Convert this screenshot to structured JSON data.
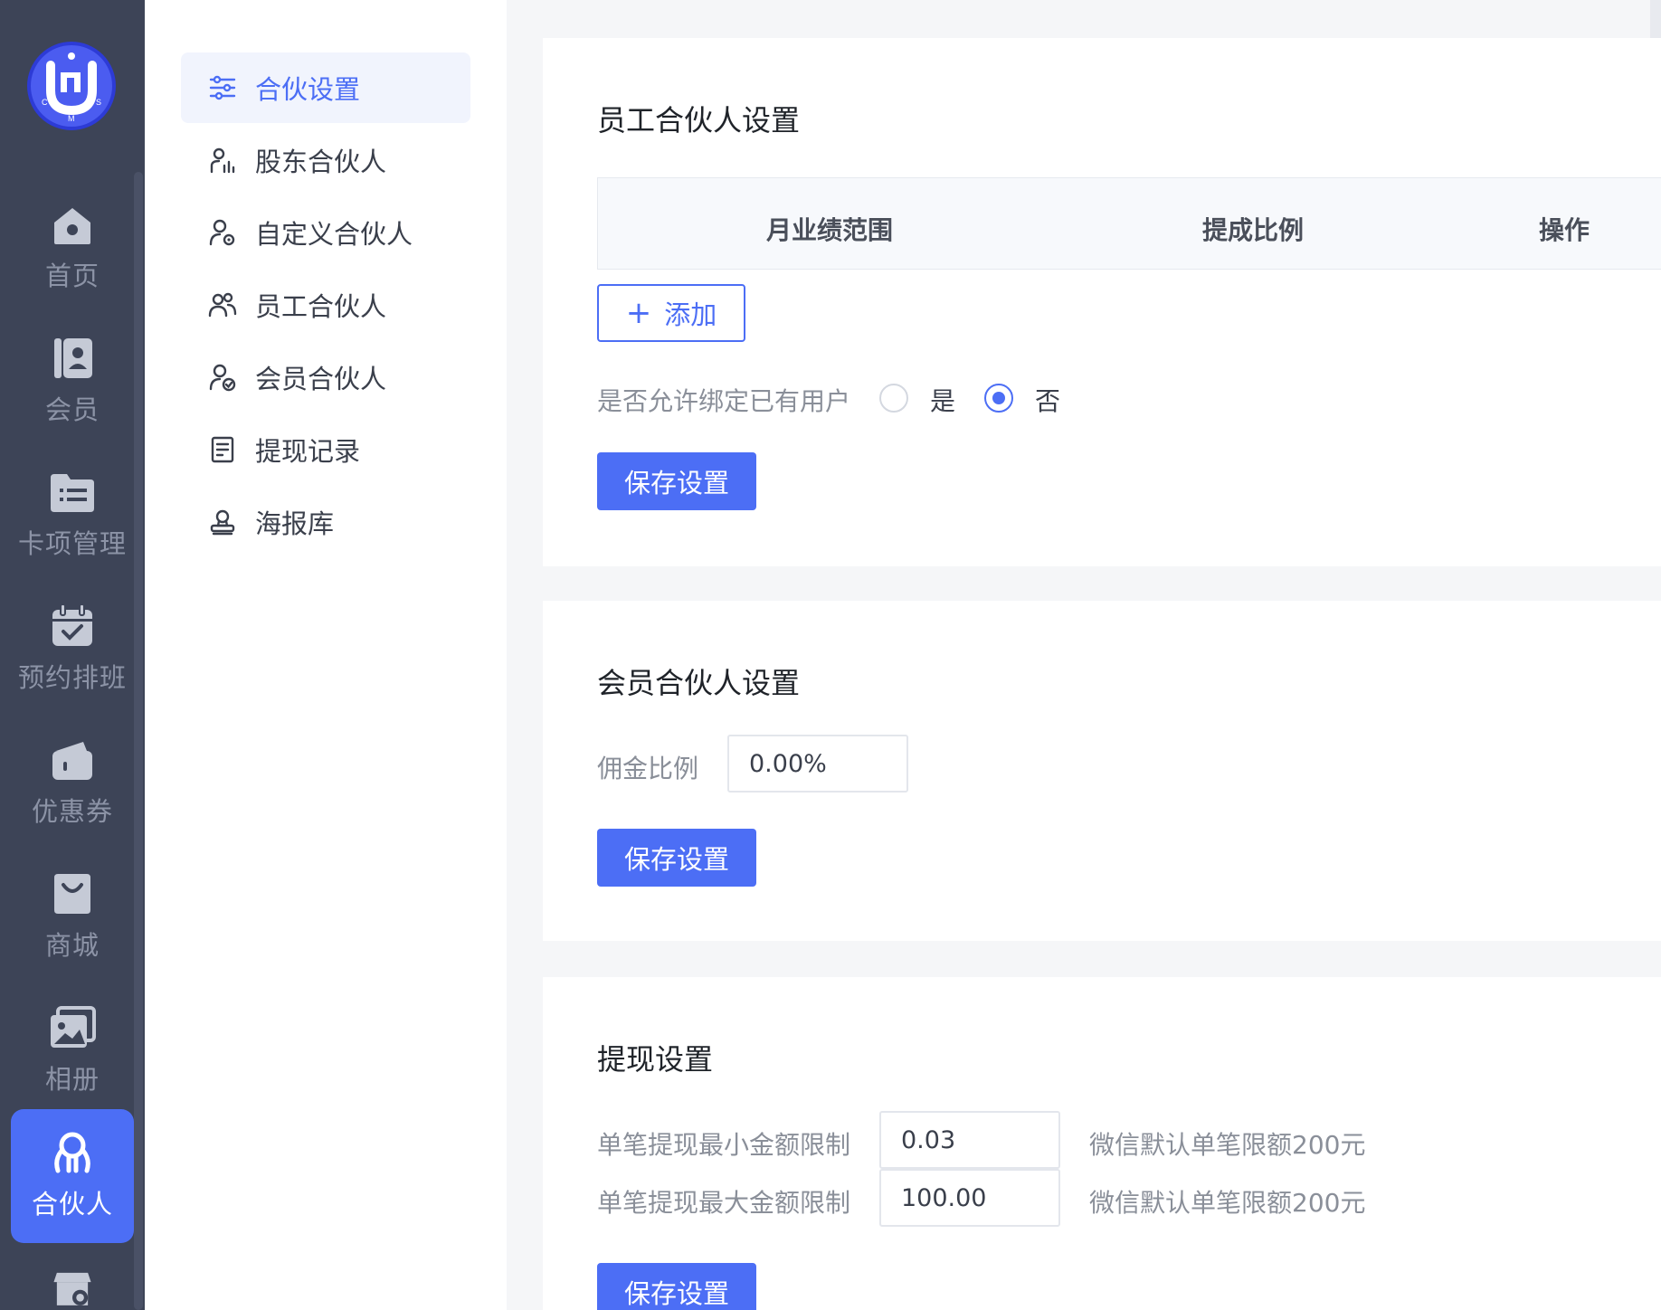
{
  "brand": {
    "logo_letters": "CMS"
  },
  "rail": {
    "items": [
      {
        "label": "首页",
        "icon": "home-icon"
      },
      {
        "label": "会员",
        "icon": "member-card-icon"
      },
      {
        "label": "卡项管理",
        "icon": "folder-list-icon"
      },
      {
        "label": "预约排班",
        "icon": "calendar-check-icon"
      },
      {
        "label": "优惠券",
        "icon": "wallet-icon"
      },
      {
        "label": "商城",
        "icon": "shopping-bag-icon"
      },
      {
        "label": "相册",
        "icon": "image-icon"
      },
      {
        "label": "合伙人",
        "icon": "partner-icon",
        "active": true
      },
      {
        "label": "",
        "icon": "shop-settings-icon"
      }
    ]
  },
  "submenu": {
    "items": [
      {
        "label": "合伙设置",
        "icon": "sliders-icon",
        "active": true
      },
      {
        "label": "股东合伙人",
        "icon": "person-chart-icon"
      },
      {
        "label": "自定义合伙人",
        "icon": "person-gear-icon"
      },
      {
        "label": "员工合伙人",
        "icon": "people-icon"
      },
      {
        "label": "会员合伙人",
        "icon": "person-check-icon"
      },
      {
        "label": "提现记录",
        "icon": "receipt-icon"
      },
      {
        "label": "海报库",
        "icon": "stamp-icon"
      }
    ]
  },
  "staff_section": {
    "title": "员工合伙人设置",
    "columns": [
      "月业绩范围",
      "提成比例",
      "操作"
    ],
    "add_label": "添加",
    "bind_label": "是否允许绑定已有用户",
    "option_yes": "是",
    "option_no": "否",
    "selected": "否",
    "save_label": "保存设置"
  },
  "member_section": {
    "title": "会员合伙人设置",
    "commission_label": "佣金比例",
    "commission_value": "0.00%",
    "save_label": "保存设置"
  },
  "withdraw_section": {
    "title": "提现设置",
    "min_label": "单笔提现最小金额限制",
    "min_value": "0.03",
    "min_hint": "微信默认单笔限额200元",
    "max_label": "单笔提现最大金额限制",
    "max_value": "100.00",
    "max_hint": "微信默认单笔限额200元",
    "save_label": "保存设置"
  },
  "colors": {
    "rail_bg": "#3d4457",
    "accent": "#4c6ef5",
    "submenu_active_bg": "#f1f4fd"
  }
}
